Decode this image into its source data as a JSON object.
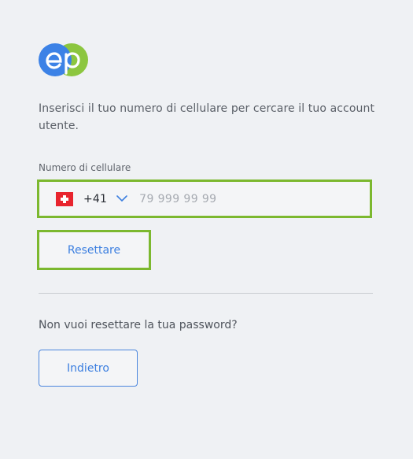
{
  "brand": {
    "logo_text": "ep",
    "primary_color": "#3c82e6",
    "secondary_color": "#8cc63f"
  },
  "intro_text": "Inserisci il tuo numero di cellulare per cercare il tuo account utente.",
  "phone": {
    "label": "Numero di cellulare",
    "country_flag": "swiss-flag-icon",
    "dial_code": "+41",
    "placeholder": "79 999 99 99",
    "value": ""
  },
  "reset_button_label": "Resettare",
  "no_reset_text": "Non vuoi resettare la tua password?",
  "back_button_label": "Indietro",
  "colors": {
    "highlight": "#7cb82f",
    "link": "#3c7fe0",
    "background": "#eff1f4"
  }
}
